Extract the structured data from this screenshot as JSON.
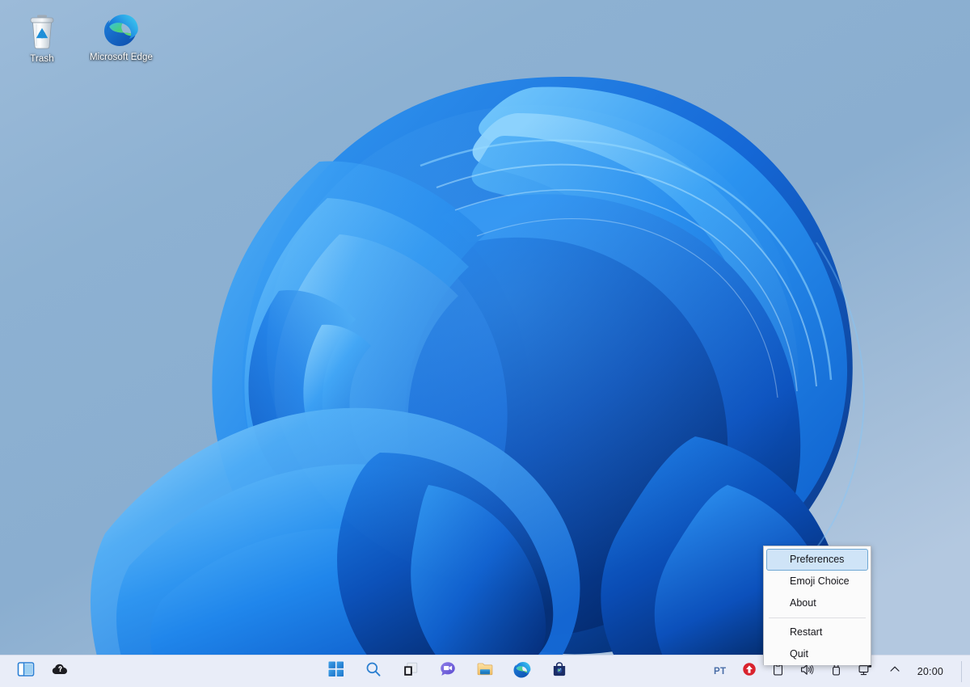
{
  "desktop": {
    "wallpaper_name": "windows-11-bloom",
    "background_colors": {
      "top_left": "#92b4d4",
      "top_right": "#7fabcf",
      "bottom_left": "#abc3dd",
      "bloom_light": "#38a4f5",
      "bloom_mid": "#1b7fe8",
      "bloom_deep": "#0b49b8",
      "bloom_dark": "#06317f"
    },
    "icons": [
      {
        "label": "Trash",
        "icon": "recycle-bin-icon"
      },
      {
        "label": "Microsoft Edge",
        "icon": "edge-icon"
      }
    ]
  },
  "context_menu": {
    "items": [
      {
        "label": "Preferences",
        "selected": true,
        "separator_before": false
      },
      {
        "label": "Emoji Choice",
        "selected": false,
        "separator_before": false
      },
      {
        "label": "About",
        "selected": false,
        "separator_before": false
      },
      {
        "label": "Restart",
        "selected": false,
        "separator_before": true
      },
      {
        "label": "Quit",
        "selected": false,
        "separator_before": false
      }
    ],
    "highlight_color": "#cfe4f7",
    "highlight_border_color": "#6fa8d4",
    "background_color": "#fbfbfb"
  },
  "taskbar": {
    "background_color": "#e9edf8",
    "left_items": [
      {
        "label": "Show Desktop Panel",
        "icon": "split-panel-icon"
      },
      {
        "label": "Cloud Sync",
        "icon": "cloud-question-icon"
      }
    ],
    "center_items": [
      {
        "label": "Start",
        "icon": "windows-start-icon"
      },
      {
        "label": "Search",
        "icon": "search-icon"
      },
      {
        "label": "Task View",
        "icon": "task-view-icon"
      },
      {
        "label": "Chat",
        "icon": "chat-icon"
      },
      {
        "label": "File Explorer",
        "icon": "file-explorer-icon"
      },
      {
        "label": "Microsoft Edge",
        "icon": "edge-icon"
      },
      {
        "label": "Microsoft Store",
        "icon": "store-icon"
      }
    ],
    "tray": {
      "language": "PT",
      "items": [
        {
          "label": "Updates Available",
          "icon": "update-arrow-icon",
          "color": "#d9232e"
        },
        {
          "label": "Clipboard",
          "icon": "clipboard-icon"
        },
        {
          "label": "Volume",
          "icon": "speaker-icon"
        },
        {
          "label": "Removable Drive",
          "icon": "usb-drive-icon"
        },
        {
          "label": "Network Display",
          "icon": "monitor-connect-icon"
        },
        {
          "label": "Show hidden icons",
          "icon": "chevron-up-icon"
        }
      ],
      "clock": "20:00"
    }
  }
}
